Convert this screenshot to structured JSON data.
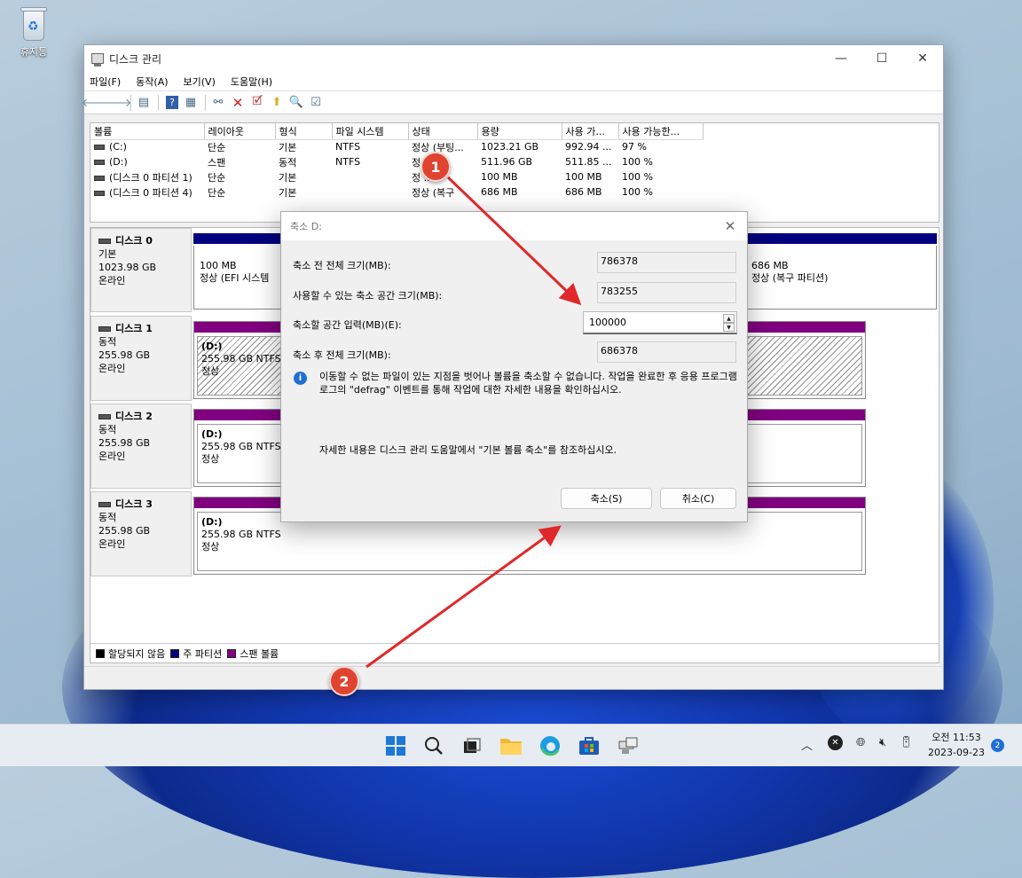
{
  "desktop": {
    "recycle_bin_label": "휴지통"
  },
  "window": {
    "title": "디스크 관리",
    "controls": {
      "minimize": "—",
      "maximize": "☐",
      "close": "✕"
    },
    "menu": [
      "파일(F)",
      "동작(A)",
      "보기(V)",
      "도움말(H)"
    ],
    "toolbar_icons": [
      "back-icon",
      "forward-icon",
      "disk-list-icon",
      "help-icon",
      "console-icon",
      "connect-icon",
      "delete-icon",
      "properties-icon",
      "up-icon",
      "search-icon",
      "settings-icon"
    ]
  },
  "volume_table": {
    "columns": [
      "볼륨",
      "레이아웃",
      "형식",
      "파일 시스템",
      "상태",
      "용량",
      "사용 가...",
      "사용 가능한..."
    ],
    "rows": [
      [
        "(C:)",
        "단순",
        "기본",
        "NTFS",
        "정상 (부팅...",
        "1023.21 GB",
        "992.94 ...",
        "97 %"
      ],
      [
        "(D:)",
        "스팬",
        "동적",
        "NTFS",
        "정",
        "511.96 GB",
        "511.85 ...",
        "100 %"
      ],
      [
        "(디스크 0 파티션 1)",
        "단순",
        "기본",
        "",
        "정 ...",
        "100 MB",
        "100 MB",
        "100 %"
      ],
      [
        "(디스크 0 파티션 4)",
        "단순",
        "기본",
        "",
        "정상 (복구",
        "686 MB",
        "686 MB",
        "100 %"
      ]
    ]
  },
  "disks": [
    {
      "name": "디스크 0",
      "type": "기본",
      "size": "1023.98 GB",
      "status": "온라인",
      "left_part": {
        "line1": "100 MB",
        "line2": "정상 (EFI 시스템"
      },
      "right_part": {
        "line1": "686 MB",
        "line2": "정상 (복구 파티션)"
      }
    },
    {
      "name": "디스크 1",
      "type": "동적",
      "size": "255.98 GB",
      "status": "온라인",
      "part": {
        "label": "(D:)",
        "line1": "255.98 GB NTFS",
        "line2": "정상"
      }
    },
    {
      "name": "디스크 2",
      "type": "동적",
      "size": "255.98 GB",
      "status": "온라인",
      "part": {
        "label": "(D:)",
        "line1": "255.98 GB NTFS",
        "line2": "정상"
      }
    },
    {
      "name": "디스크 3",
      "type": "동적",
      "size": "255.98 GB",
      "status": "온라인",
      "part": {
        "label": "(D:)",
        "line1": "255.98 GB NTFS",
        "line2": "정상"
      }
    }
  ],
  "legend": [
    {
      "label": "할당되지 않음",
      "color": "#000000"
    },
    {
      "label": "주 파티션",
      "color": "#00007f"
    },
    {
      "label": "스팬 볼륨",
      "color": "#800080"
    }
  ],
  "dialog": {
    "title": "축소 D:",
    "total_before_label": "축소 전 전체 크기(MB):",
    "total_before_value": "786378",
    "available_label": "사용할 수 있는 축소 공간 크기(MB):",
    "available_value": "783255",
    "input_label": "축소할 공간 입력(MB)(E):",
    "input_value": "100000",
    "total_after_label": "축소 후 전체 크기(MB):",
    "total_after_value": "686378",
    "info_text": "이동할 수 없는 파일이 있는 지점을 벗어나 볼륨을 축소할 수 없습니다. 작업을 완료한 후 응용 프로그램 로그의 \"defrag\" 이벤트를 통해 작업에 대한 자세한 내용을 확인하십시오.",
    "help_text": "자세한 내용은 디스크 관리 도움말에서 \"기본 볼륨 축소\"를 참조하십시오.",
    "shrink_button": "축소(S)",
    "cancel_button": "취소(C)"
  },
  "annotations": [
    "1",
    "2"
  ],
  "colors": {
    "primary": "#00007f",
    "spanned": "#800080",
    "annotation": "#e0432f"
  },
  "taskbar": {
    "icons": [
      "start-icon",
      "search-icon",
      "task-view-icon",
      "file-explorer-icon",
      "edge-icon",
      "store-icon",
      "disk-management-icon"
    ],
    "clock_time": "오전 11:53",
    "clock_date": "2023-09-23",
    "notification_count": "2"
  }
}
